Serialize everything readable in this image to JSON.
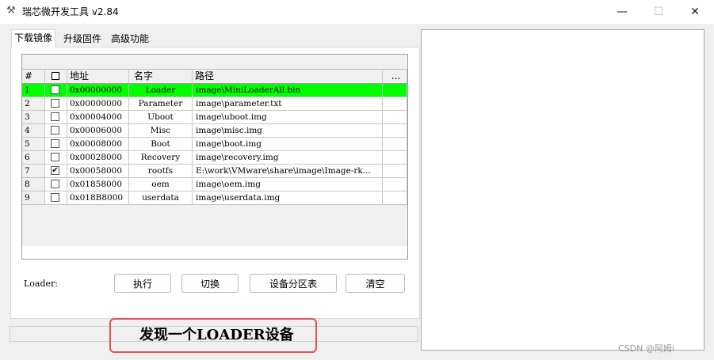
{
  "window": {
    "title": "瑞芯微开发工具 v2.84",
    "app_icon": "tools-icon",
    "minimize": "—",
    "maximize": "☐",
    "close": "✕"
  },
  "tabs": [
    {
      "label": "下载镜像",
      "active": true
    },
    {
      "label": "升级固件",
      "active": false
    },
    {
      "label": "高级功能",
      "active": false
    }
  ],
  "table": {
    "headers": {
      "num": "#",
      "checkbox": "☐",
      "address": "地址",
      "name": "名字",
      "path": "路径",
      "more": "..."
    },
    "rows": [
      {
        "num": "1",
        "checked": false,
        "address": "0x00000000",
        "name": "Loader",
        "path": "image\\MiniLoaderAll.bin",
        "highlight": true
      },
      {
        "num": "2",
        "checked": false,
        "address": "0x00000000",
        "name": "Parameter",
        "path": "image\\parameter.txt",
        "highlight": false
      },
      {
        "num": "3",
        "checked": false,
        "address": "0x00004000",
        "name": "Uboot",
        "path": "image\\uboot.img",
        "highlight": false
      },
      {
        "num": "4",
        "checked": false,
        "address": "0x00006000",
        "name": "Misc",
        "path": "image\\misc.img",
        "highlight": false
      },
      {
        "num": "5",
        "checked": false,
        "address": "0x00008000",
        "name": "Boot",
        "path": "image\\boot.img",
        "highlight": false
      },
      {
        "num": "6",
        "checked": false,
        "address": "0x00028000",
        "name": "Recovery",
        "path": "image\\recovery.img",
        "highlight": false
      },
      {
        "num": "7",
        "checked": true,
        "address": "0x00058000",
        "name": "rootfs",
        "path": "E:\\work\\VMware\\share\\image\\Image-rk...",
        "highlight": false
      },
      {
        "num": "8",
        "checked": false,
        "address": "0x01858000",
        "name": "oem",
        "path": "image\\oem.img",
        "highlight": false
      },
      {
        "num": "9",
        "checked": false,
        "address": "0x018B8000",
        "name": "userdata",
        "path": "image\\userdata.img",
        "highlight": false
      }
    ]
  },
  "actions": {
    "loader_label": "Loader:",
    "execute": "执行",
    "switch": "切换",
    "partition_table": "设备分区表",
    "clear": "清空"
  },
  "status": {
    "message": "发现一个LOADER设备"
  },
  "watermark": "CSDN @阿姆i",
  "colors": {
    "highlight_row": "#00ff00",
    "status_box_border": "#e05454"
  }
}
